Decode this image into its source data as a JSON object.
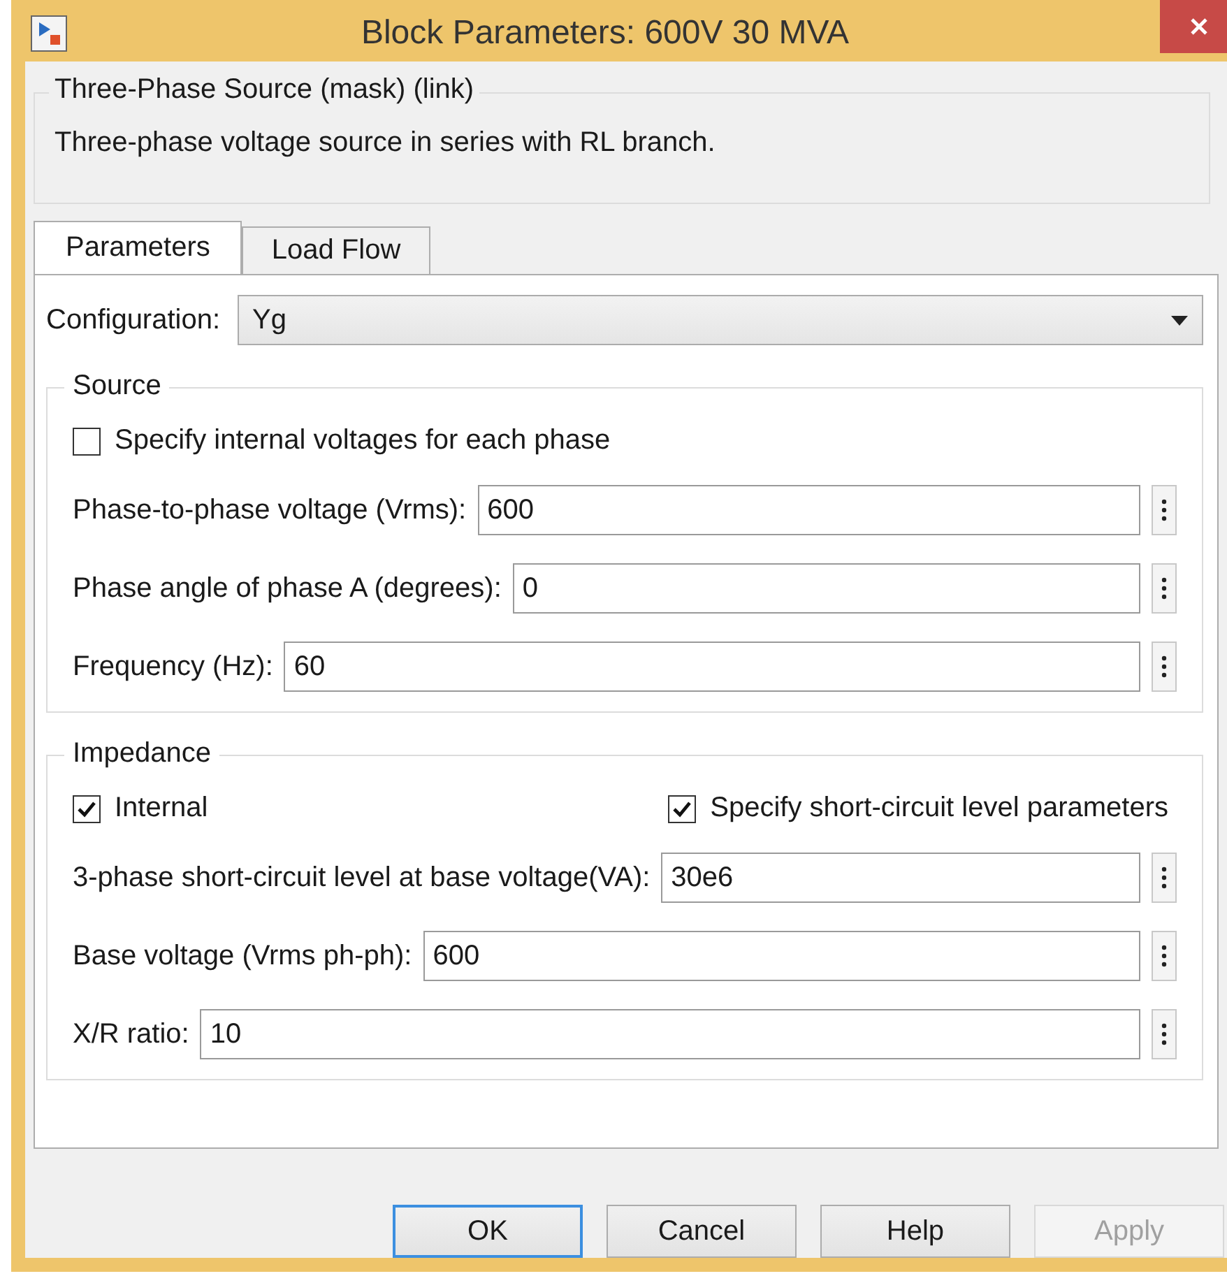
{
  "window": {
    "title": "Block Parameters: 600V 30 MVA"
  },
  "description": {
    "heading": "Three-Phase Source (mask) (link)",
    "text": "Three-phase voltage source in series with RL branch."
  },
  "tabs": [
    {
      "label": "Parameters",
      "selected": true
    },
    {
      "label": "Load Flow",
      "selected": false
    }
  ],
  "configuration": {
    "label": "Configuration:",
    "value": "Yg"
  },
  "groups": [
    {
      "title": "Source",
      "checkboxes": [
        {
          "label": "Specify internal voltages for each phase",
          "checked": false
        }
      ],
      "fields": [
        {
          "label": "Phase-to-phase voltage (Vrms):",
          "value": "600"
        },
        {
          "label": "Phase angle of phase A (degrees):",
          "value": "0"
        },
        {
          "label": "Frequency (Hz):",
          "value": "60"
        }
      ]
    },
    {
      "title": "Impedance",
      "checkboxes": [
        {
          "label": "Internal",
          "checked": true
        },
        {
          "label": "Specify short-circuit level parameters",
          "checked": true
        }
      ],
      "fields": [
        {
          "label": "3-phase short-circuit level at base voltage(VA):",
          "value": "30e6"
        },
        {
          "label": "Base voltage (Vrms ph-ph):",
          "value": "600"
        },
        {
          "label": "X/R ratio:",
          "value": "10"
        }
      ]
    }
  ],
  "buttons": [
    {
      "label": "OK",
      "default": true,
      "disabled": false
    },
    {
      "label": "Cancel",
      "default": false,
      "disabled": false
    },
    {
      "label": "Help",
      "default": false,
      "disabled": false
    },
    {
      "label": "Apply",
      "default": false,
      "disabled": true
    }
  ]
}
